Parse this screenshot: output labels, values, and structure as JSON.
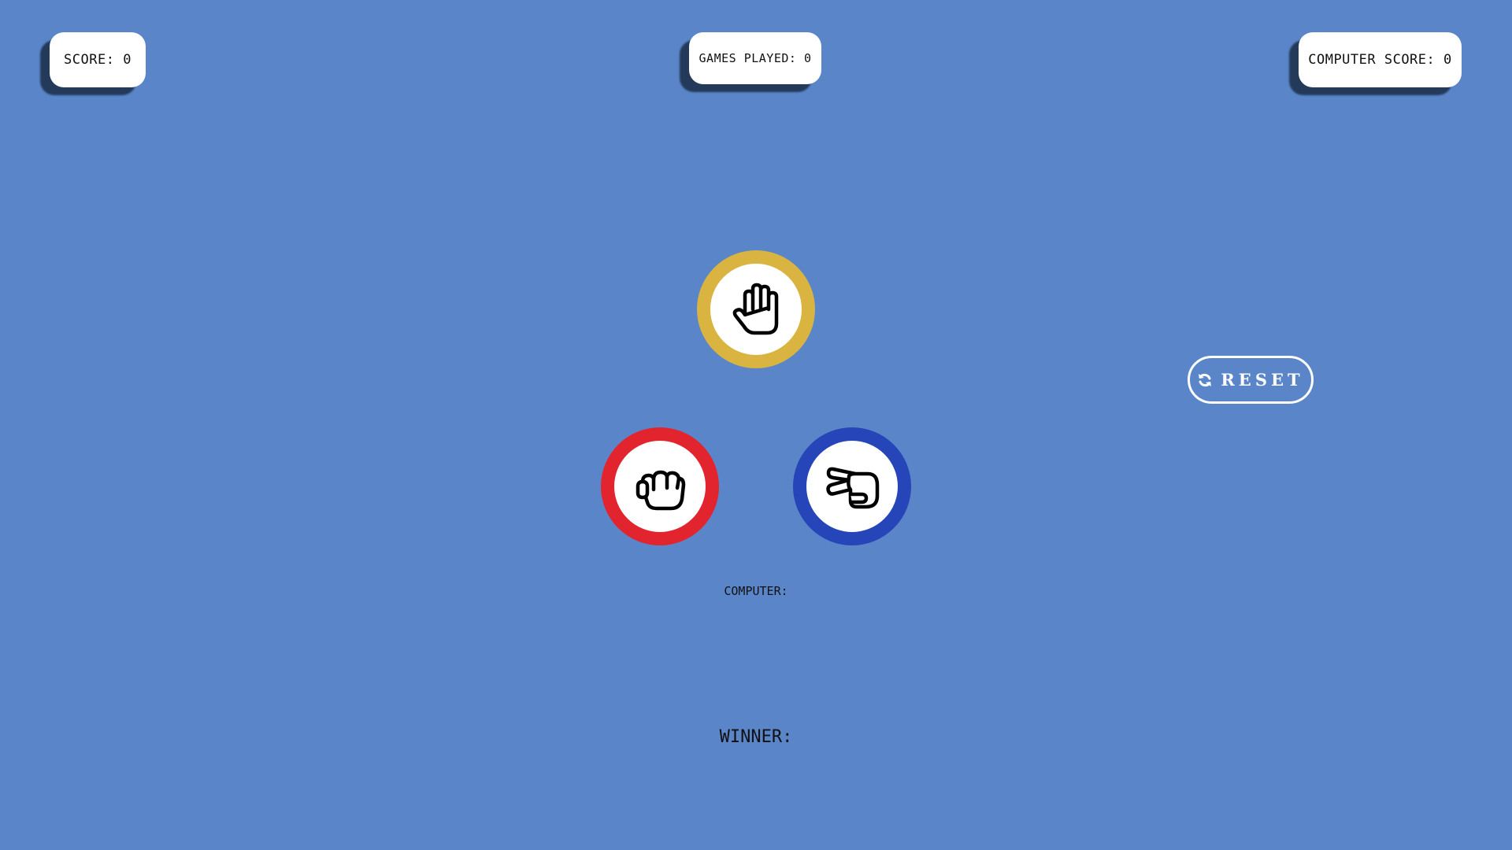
{
  "header": {
    "score_label": "SCORE:",
    "score_value": "0",
    "games_played_label": "GAMES PLAYED:",
    "games_played_value": "0",
    "computer_score_label": "COMPUTER SCORE:",
    "computer_score_value": "0"
  },
  "choices": {
    "paper": {
      "icon": "hand-paper-icon",
      "color": "#d9b441"
    },
    "rock": {
      "icon": "hand-rock-icon",
      "color": "#e2242e"
    },
    "scissors": {
      "icon": "hand-scissors-icon",
      "color": "#2545b8"
    }
  },
  "reset": {
    "label": "RESET",
    "icon": "refresh-icon"
  },
  "result": {
    "computer_label": "COMPUTER:",
    "winner_label": "WINNER:"
  },
  "colors": {
    "background": "#5a86c9",
    "pill": "#ffffff",
    "pill_shadow": "#233a5a"
  }
}
